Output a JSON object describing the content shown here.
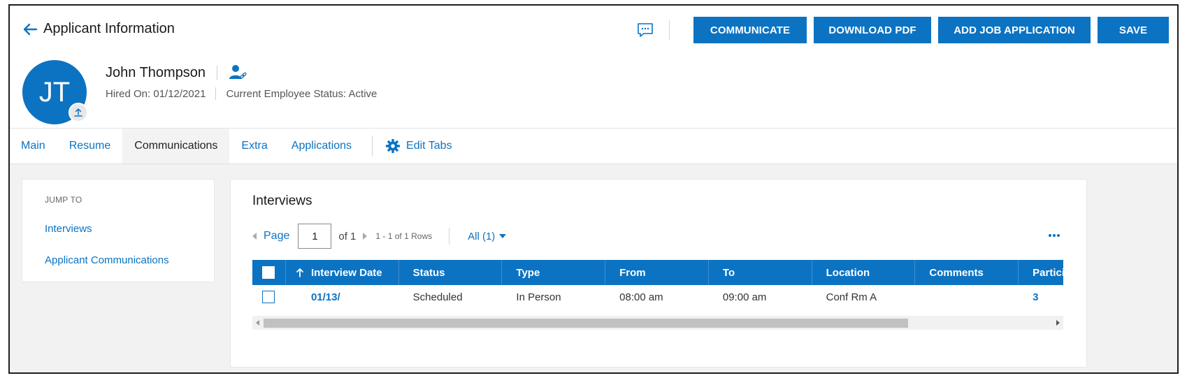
{
  "header": {
    "title": "Applicant Information",
    "actions": {
      "communicate": "COMMUNICATE",
      "download_pdf": "DOWNLOAD PDF",
      "add_job_application": "ADD JOB APPLICATION",
      "save": "SAVE"
    }
  },
  "employee": {
    "initials": "JT",
    "name": "John Thompson",
    "hired_on": "Hired On: 01/12/2021",
    "status": "Current Employee Status: Active"
  },
  "tabs": [
    {
      "label": "Main"
    },
    {
      "label": "Resume"
    },
    {
      "label": "Communications"
    },
    {
      "label": "Extra"
    },
    {
      "label": "Applications"
    }
  ],
  "edit_tabs_label": "Edit Tabs",
  "jump_to": {
    "label": "JUMP TO",
    "links": [
      "Interviews",
      "Applicant Communications"
    ]
  },
  "interviews": {
    "title": "Interviews",
    "pager": {
      "page_label": "Page",
      "page_value": "1",
      "of_label": "of 1",
      "rows_label": "1 - 1 of 1 Rows",
      "filter_label": "All (1)"
    },
    "columns": [
      "Interview Date",
      "Status",
      "Type",
      "From",
      "To",
      "Location",
      "Comments",
      "Partici"
    ],
    "rows": [
      {
        "date": "01/13/",
        "status": "Scheduled",
        "type": "In Person",
        "from": "08:00 am",
        "to": "09:00 am",
        "location": "Conf Rm A",
        "comments": "",
        "participants": "3"
      }
    ]
  },
  "colors": {
    "accent": "#0c73c2",
    "content_bg": "#f2f2f2"
  },
  "icons": [
    "back-arrow-icon",
    "chat-icon",
    "upload-icon",
    "person-link-icon",
    "gear-icon",
    "sort-up-icon",
    "more-icon"
  ]
}
